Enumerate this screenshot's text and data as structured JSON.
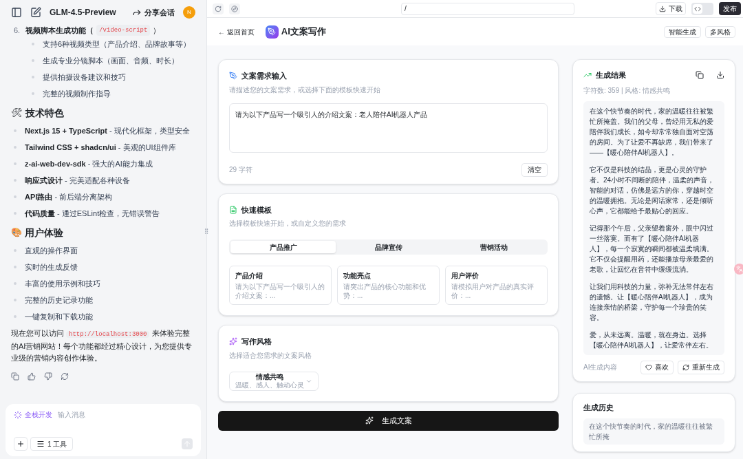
{
  "chat": {
    "title": "GLM-4.5-Preview",
    "share": "分享会话",
    "avatar": "N",
    "numbered": {
      "number": "6.",
      "title": "视频脚本生成功能（",
      "code": "/video-script",
      "close": "）",
      "items": [
        "支持6种视频类型（产品介绍、品牌故事等）",
        "生成专业分镜脚本（画面、音频、时长）",
        "提供拍摄设备建议和技巧",
        "完整的视频制作指导"
      ]
    },
    "sections": [
      {
        "icon": "🛠",
        "heading": "技术特色",
        "items": [
          {
            "bold": "Next.js 15 + TypeScript",
            "text": " - 现代化框架，类型安全"
          },
          {
            "bold": "Tailwind CSS + shadcn/ui",
            "text": " - 美观的UI组件库"
          },
          {
            "bold": "z-ai-web-dev-sdk",
            "text": " - 强大的AI能力集成"
          },
          {
            "bold": "响应式设计",
            "text": " - 完美适配各种设备"
          },
          {
            "bold": "API路由",
            "text": " - 前后端分离架构"
          },
          {
            "bold": "代码质量",
            "text": " - 通过ESLint检查，无错误警告"
          }
        ]
      },
      {
        "icon": "🎨",
        "heading": "用户体验",
        "items": [
          {
            "text": "直观的操作界面"
          },
          {
            "text": "实时的生成反馈"
          },
          {
            "text": "丰富的使用示例和技巧"
          },
          {
            "text": "完整的历史记录功能"
          },
          {
            "text": "一键复制和下载功能"
          }
        ]
      }
    ],
    "closing": {
      "before": "现在您可以访问",
      "code": "http://localhost:3000",
      "after": "来体验完整的AI营销网站！每个功能都经过精心设计，为您提供专业级的营销内容创作体验。"
    },
    "composer": {
      "mode": "全栈开发",
      "placeholder": "输入消息",
      "tools": "1 工具"
    }
  },
  "preview": {
    "url": "/",
    "download": "下载",
    "publish": "发布",
    "code_toggle": {
      "on": false
    },
    "back": "← 返回首页",
    "app_title": "AI文案写作",
    "badges": [
      "智能生成",
      "多风格"
    ],
    "input_card": {
      "title": "文案需求输入",
      "subtitle": "请描述您的文案需求，或选择下面的模板快速开始",
      "value": "请为以下产品写一个吸引人的介绍文案：老人陪伴AI机器人产品",
      "count": "29 字符",
      "clear": "清空"
    },
    "template_card": {
      "title": "快速模板",
      "subtitle": "选择模板快速开始，或自定义您的需求",
      "tabs": [
        {
          "label": "产品推广",
          "selected": true
        },
        {
          "label": "品牌宣传",
          "selected": false
        },
        {
          "label": "营销活动",
          "selected": false
        }
      ],
      "templates": [
        {
          "title": "产品介绍",
          "desc": "请为以下产品写一个吸引人的介绍文案：..."
        },
        {
          "title": "功能亮点",
          "desc": "请突出产品的核心功能和优势：..."
        },
        {
          "title": "用户评价",
          "desc": "请模拟用户对产品的真实评价：..."
        }
      ]
    },
    "style_card": {
      "title": "写作风格",
      "subtitle": "选择适合您需求的文案风格",
      "select": {
        "value": "情感共鸣",
        "desc": "温暖、感人、触动心灵"
      }
    },
    "generate": "生成文案",
    "result": {
      "title": "生成结果",
      "meta": "字符数: 359 | 风格: 情感共鸣",
      "paragraphs": [
        "在这个快节奏的时代，家的温暖往往被繁忙所掩盖。我们的父母，曾经用无私的爱陪伴我们成长，如今却常常独自面对空荡的房间。为了让爱不再缺席，我们带来了——【暖心陪伴AI机器人】。",
        "它不仅是科技的结晶，更是心灵的守护者。24小时不间断的陪伴，温柔的声音，智能的对话，仿佛是远方的你，穿越时空的温暖拥抱。无论是闲话家常，还是倾听心声，它都能给予最贴心的回应。",
        "记得那个午后，父亲望着窗外，眼中闪过一丝落寞。而有了【暖心陪伴AI机器人】，每一个寂寞的瞬间都被温柔填满。它不仅会提醒用药，还能播放母亲最爱的老歌，让回忆在音符中缓缓流淌。",
        "让我们用科技的力量，弥补无法常伴左右的遗憾。让【暖心陪伴AI机器人】，成为连接亲情的桥梁，守护每一个珍贵的笑容。",
        "爱，从未远离。温暖，就在身边。选择【暖心陪伴AI机器人】，让爱常伴左右。"
      ],
      "footer": "AI生成内容",
      "like": "喜欢",
      "regenerate": "重新生成"
    },
    "history": {
      "title": "生成历史",
      "preview": "在这个快节奏的时代，家的温暖往往被繁忙所掩"
    }
  }
}
